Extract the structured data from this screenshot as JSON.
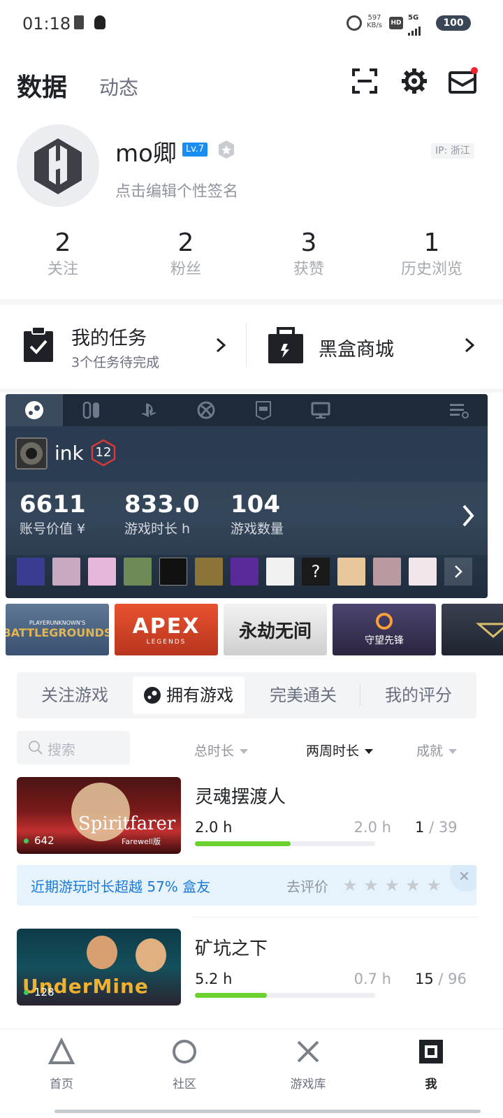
{
  "status_bar": {
    "time": "01:18",
    "net_speed": "597",
    "net_unit": "KB/s",
    "hd": "HD",
    "signal": "5G",
    "battery": "100"
  },
  "header": {
    "tab_active": "数据",
    "tab_other": "动态",
    "icons": [
      "scan-icon",
      "gear-icon",
      "mail-icon"
    ]
  },
  "profile": {
    "username": "mo卿",
    "level": "Lv.7",
    "ip": "IP: 浙江",
    "signature": "点击编辑个性签名",
    "stats": [
      {
        "value": "2",
        "label": "关注"
      },
      {
        "value": "2",
        "label": "粉丝"
      },
      {
        "value": "3",
        "label": "获赞"
      },
      {
        "value": "1",
        "label": "历史浏览"
      }
    ]
  },
  "tasks": {
    "title": "我的任务",
    "subtitle": "3个任务待完成"
  },
  "mall": {
    "title": "黑盒商城"
  },
  "steam": {
    "platforms": [
      "steam-icon",
      "switch-icon",
      "playstation-icon",
      "xbox-icon",
      "epic-icon",
      "pc-icon"
    ],
    "active_platform": "steam",
    "name": "ink",
    "level": "12",
    "stats": [
      {
        "value": "6611",
        "label": "账号价值 ¥"
      },
      {
        "value": "833.0",
        "label": "游戏时长 h"
      },
      {
        "value": "104",
        "label": "游戏数量"
      }
    ],
    "friends_count_visible": 12
  },
  "banners": [
    {
      "name": "BATTLEGROUNDS",
      "sub": "PLAYERUNKNOWN'S",
      "color": "#c9a24a"
    },
    {
      "name": "APEX",
      "sub": "LEGENDS",
      "color": "#d8462c"
    },
    {
      "name": "永劫无间",
      "sub": "",
      "color": "#e8e8e8"
    },
    {
      "name": "守望先锋",
      "sub": "",
      "color": "#3c3a58"
    },
    {
      "name": "",
      "sub": "",
      "color": "#2a2f3a"
    }
  ],
  "game_tabs": [
    {
      "label": "关注游戏"
    },
    {
      "label": "拥有游戏",
      "active": true
    },
    {
      "label": "完美通关"
    },
    {
      "label": "我的评分"
    }
  ],
  "filters": {
    "search_placeholder": "搜索",
    "sort_total": "总时长",
    "sort_recent": "两周时长",
    "sort_achievement": "成就"
  },
  "games": [
    {
      "name": "灵魂摆渡人",
      "cover_title": "Spiritfarer",
      "cover_sub": "Farewell版",
      "achievement_badge": "642",
      "total": "2.0 h",
      "recent": "2.0 h",
      "progress": 0.53,
      "ach_done": "1",
      "ach_total": "/ 39"
    },
    {
      "name": "矿坑之下",
      "cover_title": "UnderMine",
      "cover_sub": "",
      "achievement_badge": "128",
      "total": "5.2 h",
      "recent": "0.7 h",
      "progress": 0.4,
      "ach_done": "15",
      "ach_total": "/ 96"
    }
  ],
  "tip": {
    "text": "近期游玩时长超越 57% 盒友",
    "rate_label": "去评价",
    "stars": "★★★★★",
    "close": "✕"
  },
  "bottom_nav": [
    {
      "label": "首页"
    },
    {
      "label": "社区"
    },
    {
      "label": "游戏库"
    },
    {
      "label": "我",
      "active": true
    }
  ]
}
